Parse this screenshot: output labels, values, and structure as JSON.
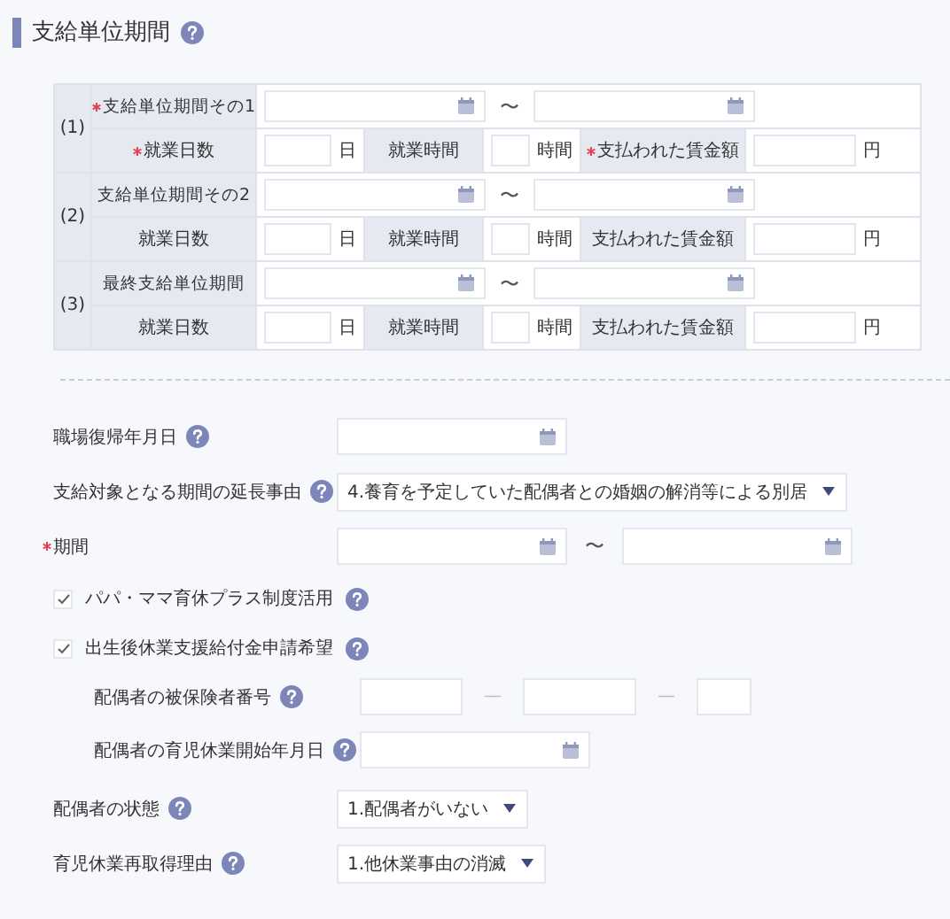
{
  "section": {
    "title": "支給単位期間",
    "help": true
  },
  "periods": [
    {
      "index": "(1)",
      "label": "支給単位期間その1",
      "required": true,
      "separator": "〜",
      "days_label": "就業日数",
      "days_required": true,
      "days_unit": "日",
      "hours_label": "就業時間",
      "hours_unit": "時間",
      "wage_label": "支払われた賃金額",
      "wage_required": true,
      "wage_unit": "円"
    },
    {
      "index": "(2)",
      "label": "支給単位期間その2",
      "required": false,
      "separator": "〜",
      "days_label": "就業日数",
      "days_required": false,
      "days_unit": "日",
      "hours_label": "就業時間",
      "hours_unit": "時間",
      "wage_label": "支払われた賃金額",
      "wage_required": false,
      "wage_unit": "円"
    },
    {
      "index": "(3)",
      "label": "最終支給単位期間",
      "required": false,
      "separator": "〜",
      "days_label": "就業日数",
      "days_required": false,
      "days_unit": "日",
      "hours_label": "就業時間",
      "hours_unit": "時間",
      "wage_label": "支払われた賃金額",
      "wage_required": false,
      "wage_unit": "円"
    }
  ],
  "fields": [
    {
      "kind": "date",
      "label": "職場復帰年月日",
      "help": true,
      "required": false
    },
    {
      "kind": "select",
      "label": "支給対象となる期間の延長事由",
      "help": true,
      "required": false,
      "value": "4.養育を予定していた配偶者との婚姻の解消等による別居"
    },
    {
      "kind": "date_range",
      "label": "期間",
      "help": false,
      "required": true,
      "separator": "〜"
    },
    {
      "kind": "checkbox",
      "label": "パパ・ママ育休プラス制度活用",
      "help": true,
      "checked": true
    },
    {
      "kind": "checkbox",
      "label": "出生後休業支援給付金申請希望",
      "help": true,
      "checked": true,
      "children": [
        {
          "kind": "insured_number",
          "label": "配偶者の被保険者番号",
          "help": true,
          "required": false,
          "separators": [
            "—",
            "—"
          ]
        },
        {
          "kind": "date",
          "label": "配偶者の育児休業開始年月日",
          "help": true,
          "required": false
        }
      ]
    },
    {
      "kind": "select",
      "label": "配偶者の状態",
      "help": true,
      "required": false,
      "value": "1.配偶者がいない"
    },
    {
      "kind": "select",
      "label": "育児休業再取得理由",
      "help": true,
      "required": false,
      "value": "1.他休業事由の消滅"
    }
  ]
}
